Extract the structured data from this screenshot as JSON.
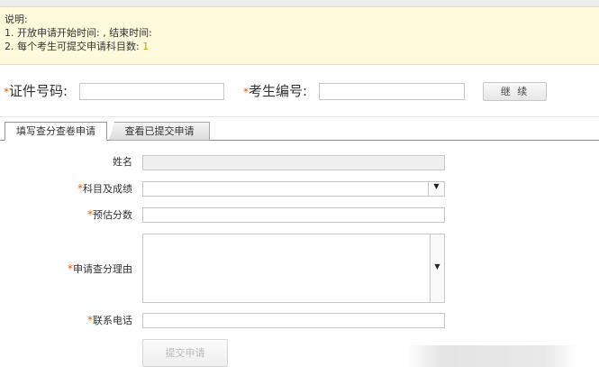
{
  "notice": {
    "title": "说明:",
    "line1": "1. 开放申请开始时间:  , 结束时间:",
    "line2_prefix": "2. 每个考生可提交申请科目数:",
    "line2_value": "1"
  },
  "lookup": {
    "id_label": "证件号码:",
    "exam_label": "考生编号:",
    "required_mark": "*",
    "continue_button": "继 续"
  },
  "tabs": {
    "fill": "填写查分查卷申请",
    "view": "查看已提交申请"
  },
  "form": {
    "name_label": "姓名",
    "subject_label": "科目及成绩",
    "estimate_label": "预估分数",
    "reason_label": "申请查分理由",
    "phone_label": "联系电话",
    "submit_button": "提交申请",
    "dropdown_arrow": "▼"
  }
}
